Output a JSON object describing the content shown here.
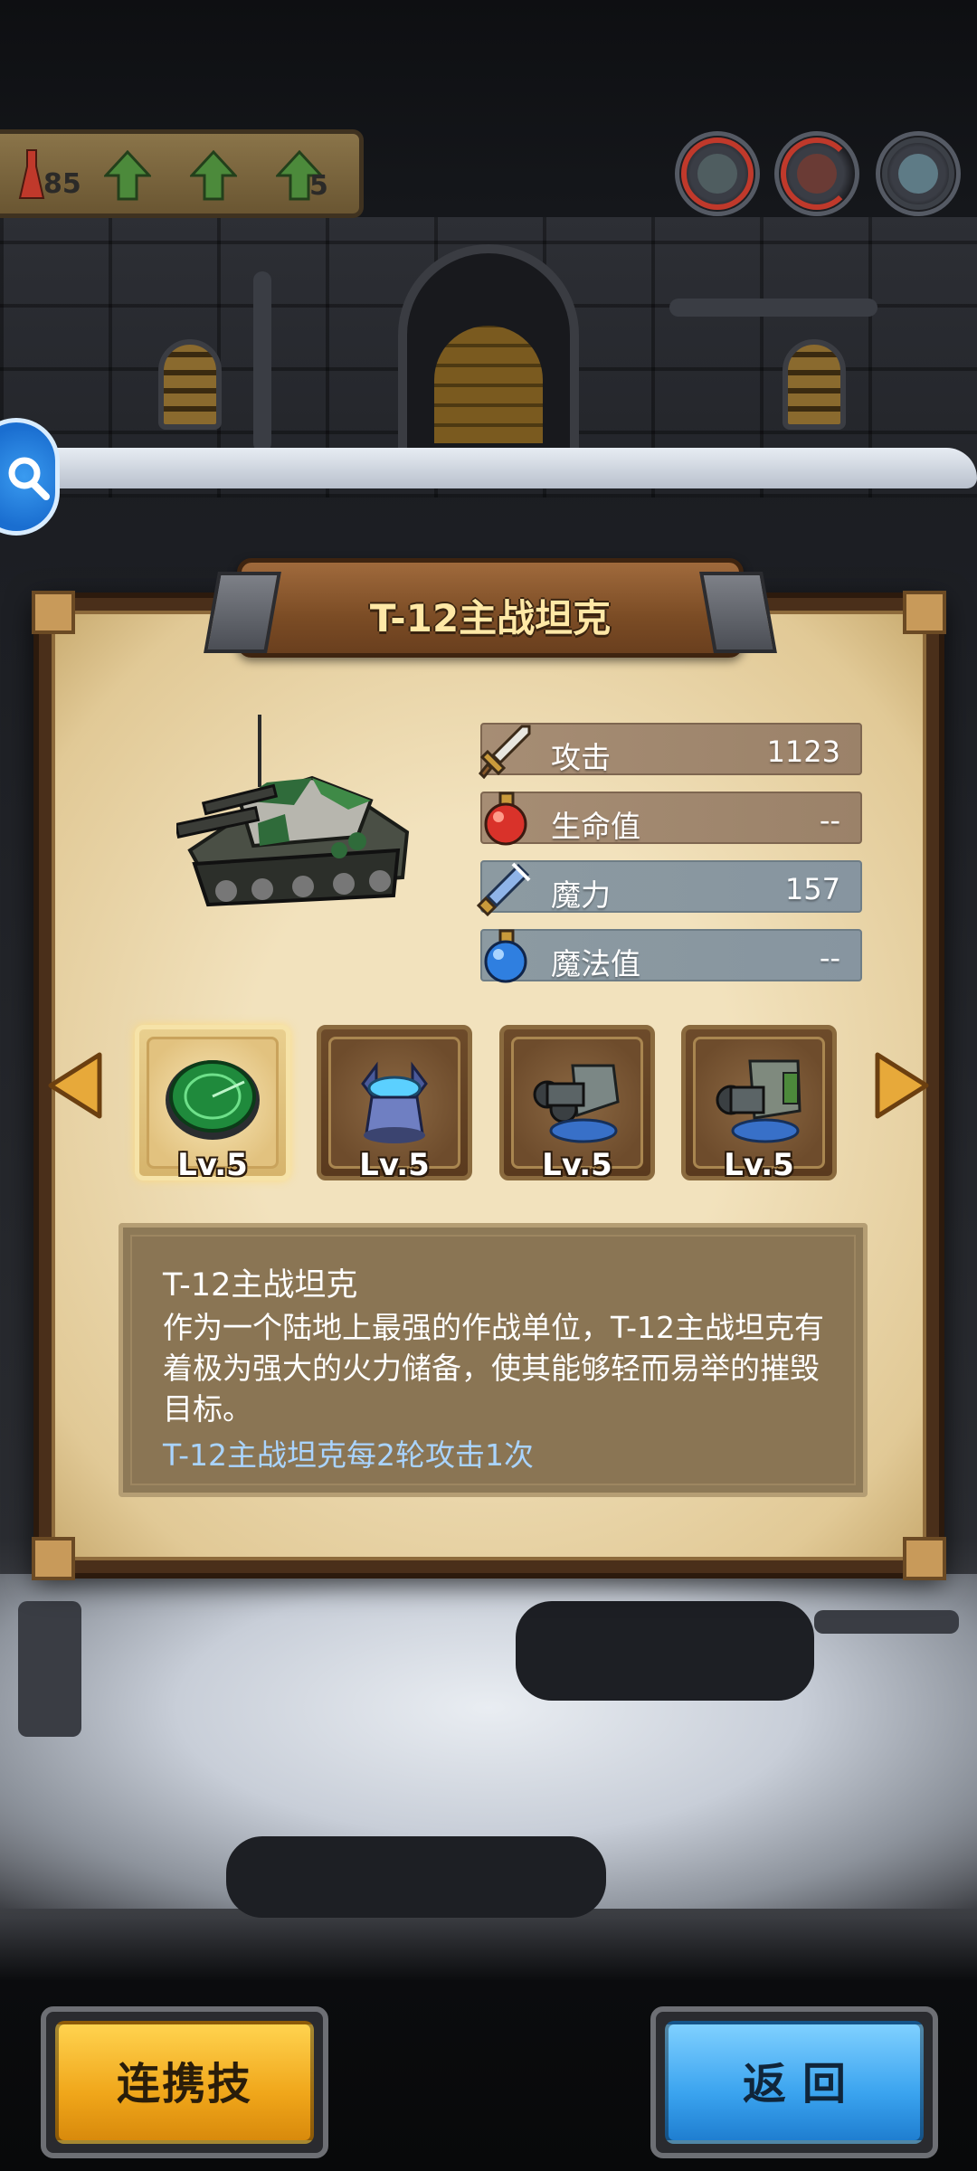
{
  "hud": {
    "resource_count": "85",
    "upgrade_count": "5",
    "hero_badges": [
      "hero-badge-1",
      "hero-badge-2",
      "hero-badge-3"
    ]
  },
  "dialog": {
    "title": "T-12主战坦克",
    "stats": [
      {
        "icon": "sword-icon",
        "label": "攻击",
        "value": "1123"
      },
      {
        "icon": "red-potion-icon",
        "label": "生命值",
        "value": "--"
      },
      {
        "icon": "magic-staff-icon",
        "label": "魔力",
        "value": "157"
      },
      {
        "icon": "blue-potion-icon",
        "label": "魔法值",
        "value": "--"
      }
    ],
    "skills": [
      {
        "icon": "radar-icon",
        "level": "Lv.5",
        "selected": true
      },
      {
        "icon": "tower-base-icon",
        "level": "Lv.5",
        "selected": false
      },
      {
        "icon": "twin-cannon-icon",
        "level": "Lv.5",
        "selected": false
      },
      {
        "icon": "heavy-cannon-icon",
        "level": "Lv.5",
        "selected": false
      }
    ],
    "description": {
      "title": "T-12主战坦克",
      "body": "作为一个陆地上最强的作战单位，T-12主战坦克有着极为强大的火力储备，使其能够轻而易举的摧毁目标。",
      "note": "T-12主战坦克每2轮攻击1次"
    }
  },
  "buttons": {
    "combo_skill": "连携技",
    "back": "返回"
  },
  "colors": {
    "panel_bg": "#f2e2bd",
    "note_text": "#a9d4ff",
    "gold_button": "#f0a61a",
    "blue_button": "#3aa3ef"
  }
}
